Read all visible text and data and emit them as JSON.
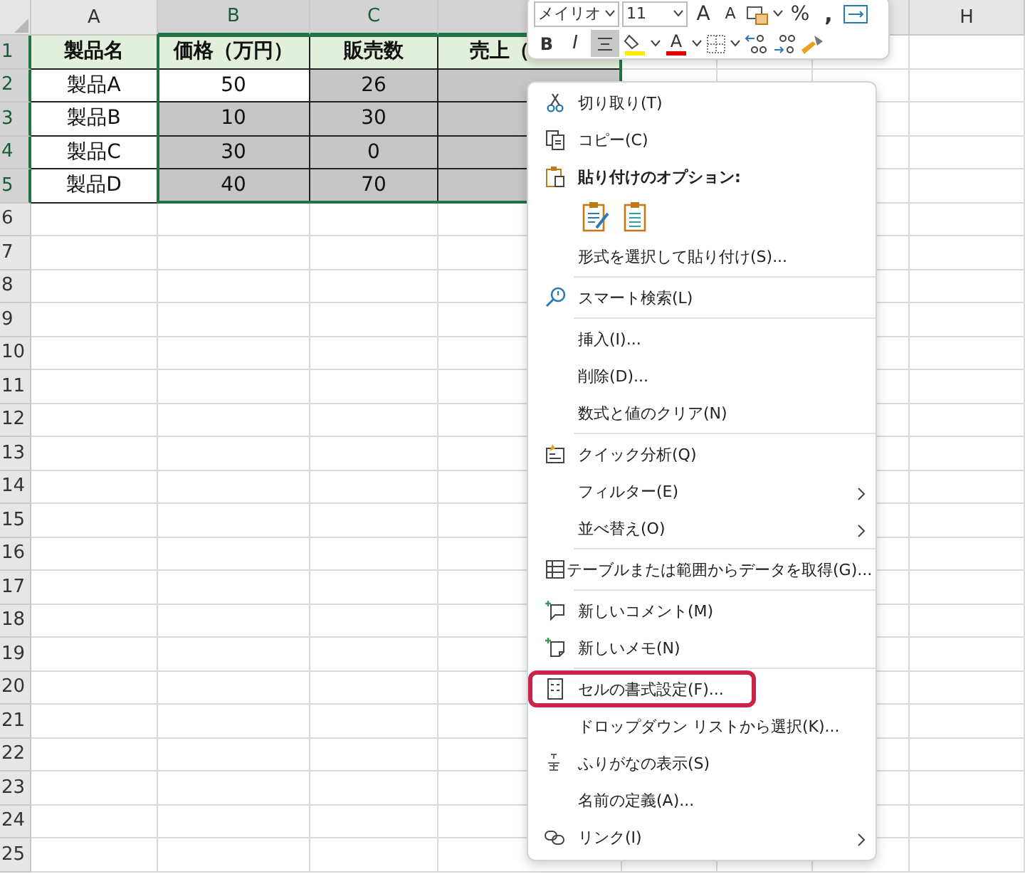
{
  "sheet": {
    "columns": [
      {
        "label": "A",
        "selected": false
      },
      {
        "label": "B",
        "selected": true
      },
      {
        "label": "C",
        "selected": true
      },
      {
        "selected": true
      },
      {},
      {},
      {
        "selected": false
      },
      {
        "label": "H",
        "selected": false
      }
    ],
    "rows": [
      {
        "label": "1",
        "selected": true,
        "cells": [
          {
            "text": "製品名",
            "kind": "heading"
          },
          {
            "text": "価格（万円）",
            "kind": "heading"
          },
          {
            "text": "販売数",
            "kind": "heading"
          },
          {
            "text": "売上（",
            "kind": "heading"
          }
        ]
      },
      {
        "label": "2",
        "selected": true,
        "cells": [
          {
            "text": "製品A",
            "kind": "value",
            "selected": false
          },
          {
            "text": "50",
            "kind": "value",
            "selected": false
          },
          {
            "text": "26",
            "kind": "value",
            "selected": true
          },
          {
            "kind": "value",
            "selected": true
          }
        ]
      },
      {
        "label": "3",
        "selected": true,
        "cells": [
          {
            "text": "製品B",
            "kind": "value",
            "selected": false
          },
          {
            "text": "10",
            "kind": "value",
            "selected": true
          },
          {
            "text": "30",
            "kind": "value",
            "selected": true
          },
          {
            "kind": "value",
            "selected": true
          }
        ]
      },
      {
        "label": "4",
        "selected": true,
        "cells": [
          {
            "text": "製品C",
            "kind": "value",
            "selected": false
          },
          {
            "text": "30",
            "kind": "value",
            "selected": true
          },
          {
            "text": "0",
            "kind": "value",
            "selected": true
          },
          {
            "kind": "value",
            "selected": true
          }
        ]
      },
      {
        "label": "5",
        "selected": true,
        "cells": [
          {
            "text": "製品D",
            "kind": "value",
            "selected": false
          },
          {
            "text": "40",
            "kind": "value",
            "selected": true
          },
          {
            "text": "70",
            "kind": "value",
            "selected": true
          },
          {
            "kind": "value",
            "selected": true
          }
        ]
      },
      {
        "label": "6",
        "selected": false
      },
      {
        "label": "7",
        "selected": false
      },
      {
        "label": "8",
        "selected": false
      },
      {
        "label": "9",
        "selected": false
      },
      {
        "label": "10",
        "selected": false
      },
      {
        "label": "11",
        "selected": false
      },
      {
        "label": "12",
        "selected": false
      },
      {
        "label": "13",
        "selected": false
      },
      {
        "label": "14",
        "selected": false
      },
      {
        "label": "15",
        "selected": false
      },
      {
        "label": "16",
        "selected": false
      },
      {
        "label": "17",
        "selected": false
      },
      {
        "label": "18",
        "selected": false
      },
      {
        "label": "19",
        "selected": false
      },
      {
        "label": "20",
        "selected": false
      },
      {
        "label": "21",
        "selected": false
      },
      {
        "label": "22",
        "selected": false
      },
      {
        "label": "23",
        "selected": false
      },
      {
        "label": "24",
        "selected": false
      },
      {
        "label": "25",
        "selected": false
      }
    ]
  },
  "mini_toolbar": {
    "font": "メイリオ",
    "size": "11",
    "grow": "A",
    "shrink": "A",
    "percent": "%",
    "comma": ",",
    "bold": "B",
    "italic": "I",
    "font_color": "A",
    "center_selected": true
  },
  "context_menu": [
    {
      "kind": "item",
      "label": "切り取り(T)",
      "submenu": false,
      "highlighted": false
    },
    {
      "kind": "item",
      "label": "コピー(C)",
      "submenu": false,
      "highlighted": false
    },
    {
      "kind": "heading",
      "label": "貼り付けのオプション:"
    },
    {
      "kind": "paste-options"
    },
    {
      "kind": "item",
      "label": "形式を選択して貼り付け(S)...",
      "submenu": false,
      "highlighted": false
    },
    {
      "kind": "separator"
    },
    {
      "kind": "item",
      "label": "スマート検索(L)",
      "submenu": false,
      "highlighted": false
    },
    {
      "kind": "separator"
    },
    {
      "kind": "item",
      "label": "挿入(I)...",
      "submenu": false,
      "highlighted": false
    },
    {
      "kind": "item",
      "label": "削除(D)...",
      "submenu": false,
      "highlighted": false
    },
    {
      "kind": "item",
      "label": "数式と値のクリア(N)",
      "submenu": false,
      "highlighted": false
    },
    {
      "kind": "separator"
    },
    {
      "kind": "item",
      "label": "クイック分析(Q)",
      "submenu": false,
      "highlighted": false
    },
    {
      "kind": "item",
      "label": "フィルター(E)",
      "submenu": true,
      "highlighted": false
    },
    {
      "kind": "item",
      "label": "並べ替え(O)",
      "submenu": true,
      "highlighted": false
    },
    {
      "kind": "separator"
    },
    {
      "kind": "item",
      "label": "テーブルまたは範囲からデータを取得(G)...",
      "submenu": false,
      "highlighted": false
    },
    {
      "kind": "separator"
    },
    {
      "kind": "item",
      "label": "新しいコメント(M)",
      "submenu": false,
      "highlighted": false
    },
    {
      "kind": "item",
      "label": "新しいメモ(N)",
      "submenu": false,
      "highlighted": false
    },
    {
      "kind": "separator"
    },
    {
      "kind": "item",
      "label": "セルの書式設定(F)...",
      "submenu": false,
      "highlighted": true
    },
    {
      "kind": "item",
      "label": "ドロップダウン リストから選択(K)...",
      "submenu": false,
      "highlighted": false
    },
    {
      "kind": "item",
      "label": "ふりがなの表示(S)",
      "submenu": false,
      "highlighted": false
    },
    {
      "kind": "item",
      "label": "名前の定義(A)...",
      "submenu": false,
      "highlighted": false
    },
    {
      "kind": "item",
      "label": "リンク(I)",
      "submenu": true,
      "highlighted": false
    }
  ]
}
